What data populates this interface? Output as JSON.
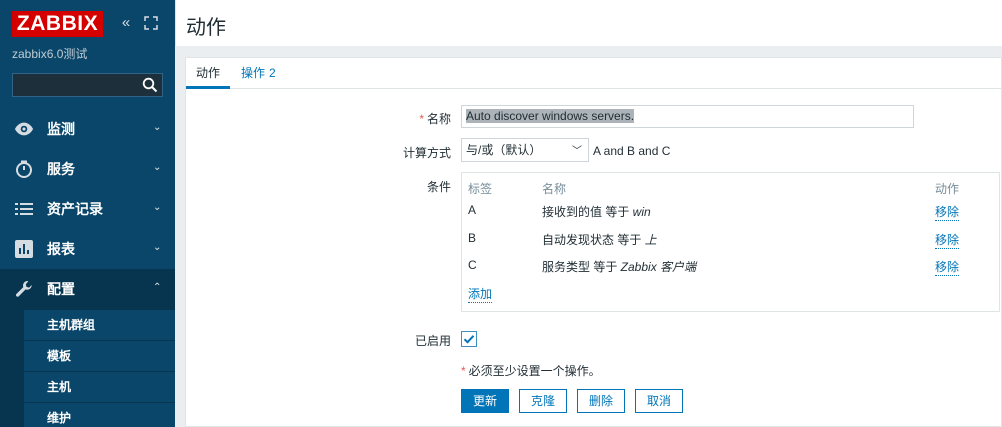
{
  "sidebar": {
    "logo": "ZABBIX",
    "server_name": "zabbix6.0测试",
    "search": {
      "value": "",
      "placeholder": ""
    },
    "menu": [
      {
        "label": "监测",
        "icon": "eye-icon"
      },
      {
        "label": "服务",
        "icon": "clock-icon"
      },
      {
        "label": "资产记录",
        "icon": "list-icon"
      },
      {
        "label": "报表",
        "icon": "bar-chart-icon"
      },
      {
        "label": "配置",
        "icon": "wrench-icon"
      }
    ],
    "submenu": [
      "主机群组",
      "模板",
      "主机",
      "维护"
    ]
  },
  "page": {
    "title": "动作"
  },
  "tabs": {
    "action": "动作",
    "operations": "操作",
    "operations_count": "2"
  },
  "form": {
    "name_label": "名称",
    "name_value": "Auto discover windows servers.",
    "calc_label": "计算方式",
    "calc_value": "与/或（默认）",
    "calc_formula": "A and B and C",
    "conditions_label": "条件",
    "conditions_headers": {
      "label": "标签",
      "name": "名称",
      "action": "动作"
    },
    "conditions": [
      {
        "label": "A",
        "name_prefix": "接收到的值 等于 ",
        "name_value": "win",
        "action": "移除"
      },
      {
        "label": "B",
        "name_prefix": "自动发现状态 等于 ",
        "name_value": "上",
        "action": "移除"
      },
      {
        "label": "C",
        "name_prefix": "服务类型 等于 ",
        "name_value": "Zabbix 客户端",
        "action": "移除"
      }
    ],
    "add_label": "添加",
    "enabled_label": "已启用",
    "enabled": true,
    "required_note": "必须至少设置一个操作。",
    "buttons": {
      "update": "更新",
      "clone": "克隆",
      "delete": "删除",
      "cancel": "取消"
    }
  },
  "colors": {
    "sidebar": "#0a466a",
    "logo": "#d40000",
    "accent": "#0275b8",
    "required": "#e45959"
  }
}
